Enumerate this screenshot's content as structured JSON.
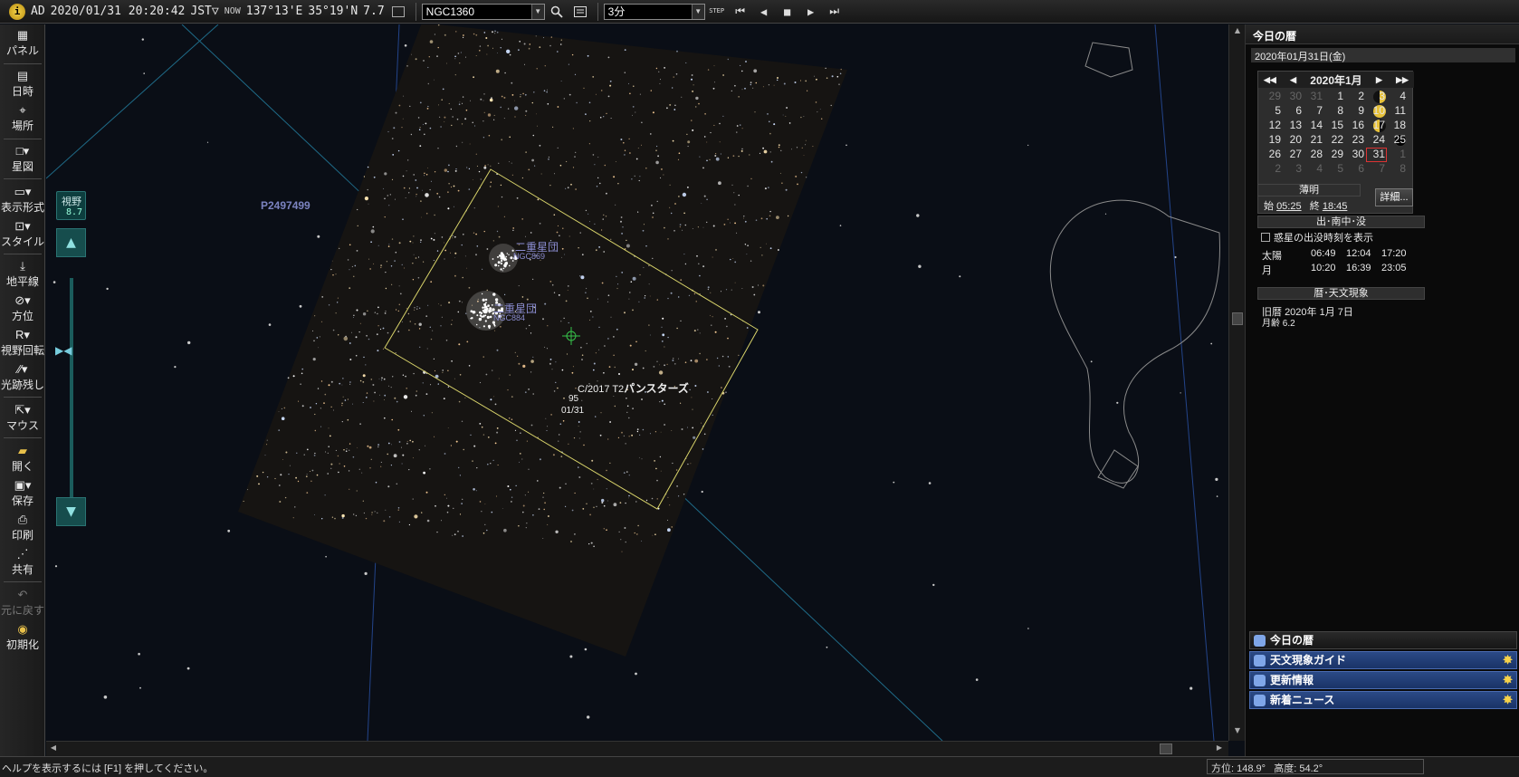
{
  "topbar": {
    "era": "AD",
    "datetime": "2020/01/31 20:20:42",
    "tz": "JST▽",
    "now_label": "NOW",
    "longitude": "137°13'E",
    "latitude": "35°19'N",
    "fov_value": "7.7",
    "search_value": "NGC1360",
    "step_value": "3分",
    "step_label": "STEP"
  },
  "left_toolbar": {
    "items": [
      {
        "label": "パネル",
        "icon": "panel-icon"
      },
      {
        "label": "日時",
        "icon": "calendar-icon"
      },
      {
        "label": "場所",
        "icon": "location-icon"
      },
      {
        "label": "星図",
        "icon": "chart-icon"
      },
      {
        "label": "表示形式",
        "icon": "display-icon"
      },
      {
        "label": "スタイル",
        "icon": "style-icon"
      },
      {
        "label": "地平線",
        "icon": "horizon-icon"
      },
      {
        "label": "方位",
        "icon": "compass-icon"
      },
      {
        "label": "視野回転",
        "icon": "rotate-icon"
      },
      {
        "label": "光跡残し",
        "icon": "trail-icon"
      },
      {
        "label": "マウス",
        "icon": "mouse-icon"
      },
      {
        "label": "開く",
        "icon": "open-folder-icon"
      },
      {
        "label": "保存",
        "icon": "save-icon"
      },
      {
        "label": "印刷",
        "icon": "print-icon"
      },
      {
        "label": "共有",
        "icon": "share-icon"
      },
      {
        "label": "元に戻す",
        "icon": "undo-icon"
      },
      {
        "label": "初期化",
        "icon": "reset-icon"
      }
    ]
  },
  "sky": {
    "fov_badge_label": "視野",
    "fov_badge_value": "8.7",
    "zoom_level": 0.32,
    "object_p": "P2497499",
    "cluster1_name": "二重星団",
    "cluster1_sub": "NGC869",
    "cluster2_name": "二重星団",
    "cluster2_sub": "NGC884",
    "comet_name": "C/2017 T2",
    "comet_kana": "パンスターズ",
    "comet_mag": "95",
    "comet_date": "01/31"
  },
  "right_panel": {
    "title": "今日の暦",
    "date": "2020年01月31日(金)",
    "calendar": {
      "month_label": "2020年1月",
      "nav_prev_year": "◀◀",
      "nav_prev_month": "◀",
      "nav_next_month": "▶",
      "nav_next_year": "▶▶",
      "rows": [
        [
          "29",
          "30",
          "31",
          "1",
          "2",
          "3",
          "4"
        ],
        [
          "5",
          "6",
          "7",
          "8",
          "9",
          "10",
          "11"
        ],
        [
          "12",
          "13",
          "14",
          "15",
          "16",
          "17",
          "18"
        ],
        [
          "19",
          "20",
          "21",
          "22",
          "23",
          "24",
          "25"
        ],
        [
          "26",
          "27",
          "28",
          "29",
          "30",
          "31",
          "1"
        ],
        [
          "2",
          "3",
          "4",
          "5",
          "6",
          "7",
          "8"
        ]
      ]
    },
    "twilight_label": "薄明",
    "twilight_start_label": "始",
    "twilight_start": "05:25",
    "twilight_end_label": "終",
    "twilight_end": "18:45",
    "detail_button": "詳細...",
    "rise_header": "出･南中･没",
    "planet_checkbox": "惑星の出没時刻を表示",
    "sun_label": "太陽",
    "sun_rise": "06:49",
    "sun_transit": "12:04",
    "sun_set": "17:20",
    "moon_label": "月",
    "moon_rise": "10:20",
    "moon_transit": "16:39",
    "moon_set": "23:05",
    "events_header": "暦･天文現象",
    "lunar_label": "旧暦",
    "lunar_date": "2020年 1月 7日",
    "moon_age_label": "月齢",
    "moon_age": "6.2",
    "tabs": [
      {
        "label": "今日の暦"
      },
      {
        "label": "天文現象ガイド"
      },
      {
        "label": "更新情報"
      },
      {
        "label": "新着ニュース"
      }
    ]
  },
  "status": {
    "help": "ヘルプを表示するには [F1] を押してください。",
    "azimuth_label": "方位:",
    "azimuth": "148.9°",
    "altitude_label": "高度:",
    "altitude": "54.2°"
  },
  "colors": {
    "sky_bg": "#0a0e16",
    "accent_teal": "#164d4d",
    "moon_yellow": "#e6c13a",
    "tab_blue": "#2b4a86",
    "fov_rect": "#d8d36a"
  }
}
